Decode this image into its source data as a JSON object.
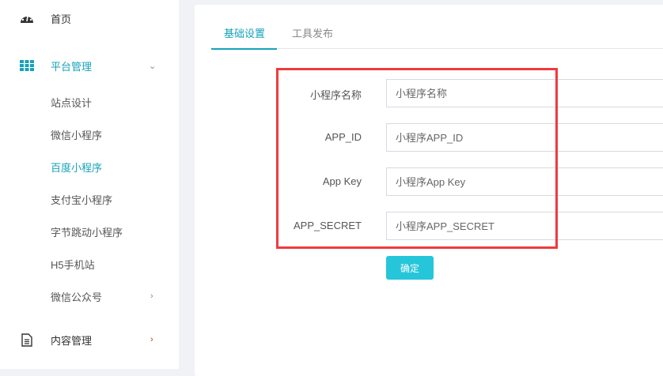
{
  "sidebar": {
    "home": "首页",
    "platform": "平台管理",
    "sub_items": [
      "站点设计",
      "微信小程序",
      "百度小程序",
      "支付宝小程序",
      "字节跳动小程序",
      "H5手机站",
      "微信公众号"
    ],
    "content": "内容管理"
  },
  "tabs": [
    "基础设置",
    "工具发布"
  ],
  "form": {
    "fields": [
      {
        "label": "小程序名称",
        "placeholder": "小程序名称"
      },
      {
        "label": "APP_ID",
        "placeholder": "小程序APP_ID"
      },
      {
        "label": "App Key",
        "placeholder": "小程序App Key"
      },
      {
        "label": "APP_SECRET",
        "placeholder": "小程序APP_SECRET"
      }
    ],
    "submit": "确定"
  },
  "colors": {
    "accent": "#17a2b8",
    "button": "#26c6da",
    "highlight": "#f03a3d"
  }
}
